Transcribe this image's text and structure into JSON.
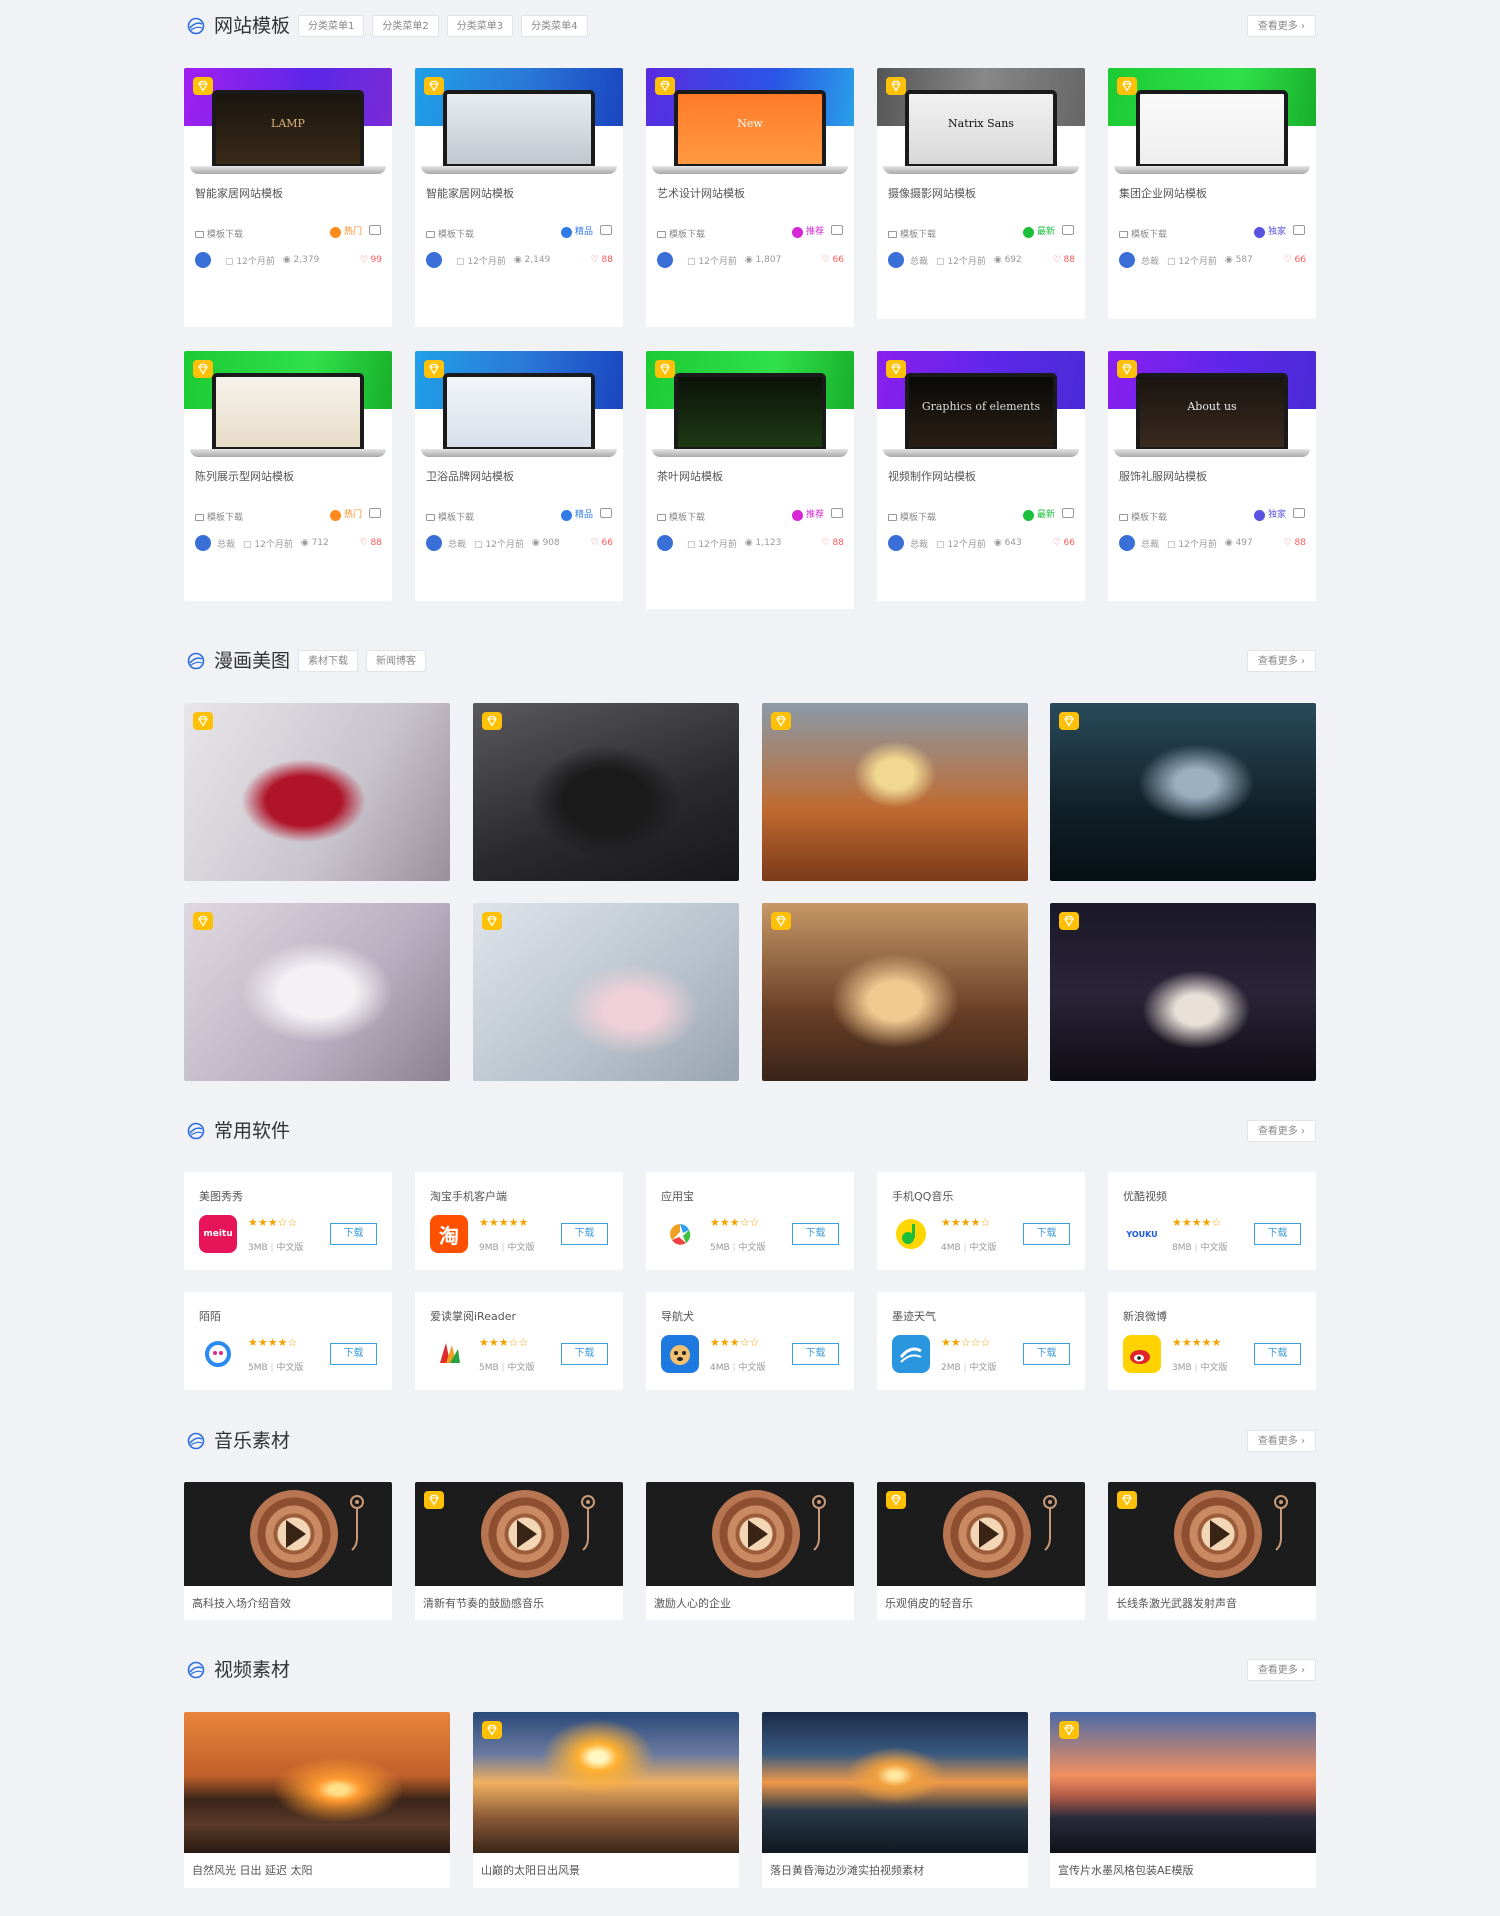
{
  "colors": {
    "accent": "#3a6fd8",
    "vip": "#ffc107",
    "like": "#ff5a5a",
    "stars": "#f4a300",
    "download": "#3a9ad9"
  },
  "icons": {
    "section": "globe-icon",
    "vip": "diamond-icon",
    "category": "folder-icon",
    "chat": "chat-icon",
    "time": "calendar-icon",
    "views": "eye-icon",
    "likes": "heart-icon"
  },
  "templates": {
    "title": "网站模板",
    "tabs": [
      "分类菜单1",
      "分类菜单2",
      "分类菜单3",
      "分类菜单4"
    ],
    "more": "查看更多 ›",
    "items": [
      {
        "title": "智能家居网站模板",
        "cat": "模板下载",
        "badge": "热门",
        "author": "",
        "time": "12个月前",
        "views": "2,379",
        "likes": "99",
        "screen": "LAMP"
      },
      {
        "title": "智能家居网站模板",
        "cat": "模板下载",
        "badge": "精品",
        "author": "",
        "time": "12个月前",
        "views": "2,149",
        "likes": "88",
        "screen": ""
      },
      {
        "title": "艺术设计网站模板",
        "cat": "模板下载",
        "badge": "推荐",
        "author": "",
        "time": "12个月前",
        "views": "1,807",
        "likes": "66",
        "screen": "New"
      },
      {
        "title": "摄像摄影网站模板",
        "cat": "模板下载",
        "badge": "最新",
        "author": "总裁",
        "time": "12个月前",
        "views": "692",
        "likes": "88",
        "screen": "Natrix Sans"
      },
      {
        "title": "集团企业网站模板",
        "cat": "模板下载",
        "badge": "独家",
        "author": "总裁",
        "time": "12个月前",
        "views": "587",
        "likes": "66",
        "screen": ""
      },
      {
        "title": "陈列展示型网站模板",
        "cat": "模板下载",
        "badge": "热门",
        "author": "总裁",
        "time": "12个月前",
        "views": "712",
        "likes": "88",
        "screen": ""
      },
      {
        "title": "卫浴品牌网站模板",
        "cat": "模板下载",
        "badge": "精品",
        "author": "总裁",
        "time": "12个月前",
        "views": "908",
        "likes": "66",
        "screen": ""
      },
      {
        "title": "茶叶网站模板",
        "cat": "模板下载",
        "badge": "推荐",
        "author": "",
        "time": "12个月前",
        "views": "1,123",
        "likes": "88",
        "screen": ""
      },
      {
        "title": "视频制作网站模板",
        "cat": "模板下载",
        "badge": "最新",
        "author": "总裁",
        "time": "12个月前",
        "views": "643",
        "likes": "66",
        "screen": "Graphics of elements"
      },
      {
        "title": "服饰礼服网站模板",
        "cat": "模板下载",
        "badge": "独家",
        "author": "总裁",
        "time": "12个月前",
        "views": "497",
        "likes": "88",
        "screen": "About us"
      }
    ]
  },
  "comics": {
    "title": "漫画美图",
    "tabs": [
      "素材下载",
      "新闻博客"
    ],
    "more": "查看更多 ›",
    "count": 8
  },
  "software": {
    "title": "常用软件",
    "more": "查看更多 ›",
    "items": [
      {
        "name": "美图秀秀",
        "rating": 3,
        "size": "3MB",
        "lang": "中文版",
        "btn": "下载",
        "icon": "meitu",
        "glyph": "meitu"
      },
      {
        "name": "淘宝手机客户端",
        "rating": 5,
        "size": "9MB",
        "lang": "中文版",
        "btn": "下载",
        "icon": "taobao",
        "glyph": "淘"
      },
      {
        "name": "应用宝",
        "rating": 3,
        "size": "5MB",
        "lang": "中文版",
        "btn": "下载",
        "icon": "yyb",
        "glyph": ""
      },
      {
        "name": "手机QQ音乐",
        "rating": 4,
        "size": "4MB",
        "lang": "中文版",
        "btn": "下载",
        "icon": "qqmusic",
        "glyph": ""
      },
      {
        "name": "优酷视频",
        "rating": 4,
        "size": "8MB",
        "lang": "中文版",
        "btn": "下载",
        "icon": "youku",
        "glyph": "YOUKU"
      },
      {
        "name": "陌陌",
        "rating": 4,
        "size": "5MB",
        "lang": "中文版",
        "btn": "下载",
        "icon": "momo",
        "glyph": ""
      },
      {
        "name": "爱读掌阅iReader",
        "rating": 3,
        "size": "5MB",
        "lang": "中文版",
        "btn": "下载",
        "icon": "ireader",
        "glyph": ""
      },
      {
        "name": "导航犬",
        "rating": 3,
        "size": "4MB",
        "lang": "中文版",
        "btn": "下载",
        "icon": "dog",
        "glyph": ""
      },
      {
        "name": "墨迹天气",
        "rating": 2,
        "size": "2MB",
        "lang": "中文版",
        "btn": "下载",
        "icon": "weather",
        "glyph": ""
      },
      {
        "name": "新浪微博",
        "rating": 5,
        "size": "3MB",
        "lang": "中文版",
        "btn": "下载",
        "icon": "weibo",
        "glyph": ""
      }
    ]
  },
  "music": {
    "title": "音乐素材",
    "more": "查看更多 ›",
    "items": [
      {
        "title": "高科技入场介绍音效",
        "vip": false
      },
      {
        "title": "清新有节奏的鼓励感音乐",
        "vip": true
      },
      {
        "title": "激励人心的企业",
        "vip": false
      },
      {
        "title": "乐观俏皮的轻音乐",
        "vip": true
      },
      {
        "title": "长线条激光武器发射声音",
        "vip": true
      }
    ]
  },
  "video": {
    "title": "视频素材",
    "more": "查看更多 ›",
    "items": [
      {
        "title": "自然风光 日出 延迟 太阳",
        "vip": false
      },
      {
        "title": "山巅的太阳日出风景",
        "vip": true
      },
      {
        "title": "落日黄昏海边沙滩实拍视频素材",
        "vip": false
      },
      {
        "title": "宣传片水墨风格包装AE模版",
        "vip": true
      }
    ]
  }
}
